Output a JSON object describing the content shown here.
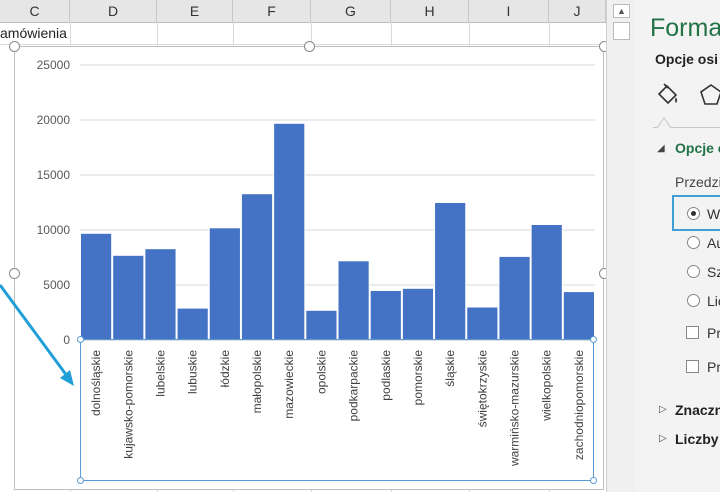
{
  "spreadsheet": {
    "columns": [
      "C",
      "D",
      "E",
      "F",
      "G",
      "H",
      "I",
      "J"
    ],
    "cell_text": "amówienia"
  },
  "chart_data": {
    "type": "bar",
    "title": "",
    "xlabel": "",
    "ylabel": "",
    "ylim": [
      0,
      25000
    ],
    "yticks": [
      "25000",
      "20000",
      "15000",
      "10000",
      "5000",
      "0"
    ],
    "bar_color": "#4472c4",
    "categories": [
      "dolnośląskie",
      "kujawsko-pomorskie",
      "lubelskie",
      "lubuskie",
      "łódzkie",
      "małopolskie",
      "mazowieckie",
      "opolskie",
      "podkarpackie",
      "podlaskie",
      "pomorskie",
      "śląskie",
      "świętokrzyskie",
      "warmińsko-mazurskie",
      "wielkopolskie",
      "zachodniopomorskie"
    ],
    "values": [
      9700,
      7700,
      8300,
      2900,
      10200,
      13300,
      19700,
      2700,
      7200,
      4500,
      4700,
      12500,
      3000,
      7600,
      10500,
      4400
    ],
    "grid": true,
    "legend": "none"
  },
  "format_pane": {
    "title": "Forma",
    "subtitle": "Opcje osi",
    "icons": [
      "fill-bucket-icon",
      "pentagon-icon"
    ],
    "section_title": "Opcje o",
    "section_label": "Przedzi",
    "options": [
      {
        "label": "W",
        "selected": true
      },
      {
        "label": "Au",
        "selected": false
      },
      {
        "label": "Sz",
        "selected": false
      },
      {
        "label": "Lic",
        "selected": false
      }
    ],
    "checkboxes": [
      {
        "label": "Pr",
        "checked": false
      },
      {
        "label": "Pr",
        "checked": false
      }
    ],
    "collapsed_sections": [
      "Znaczn",
      "Liczby"
    ],
    "accent_color": "#217346"
  }
}
